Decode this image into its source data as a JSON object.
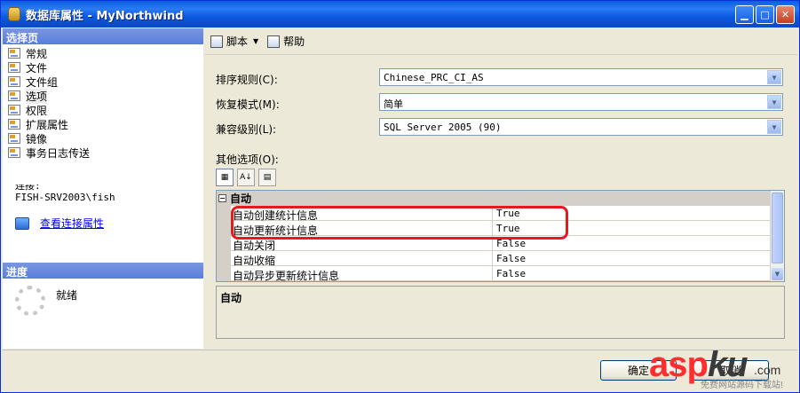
{
  "window": {
    "title": "数据库属性 - MyNorthwind",
    "minimize_label": "▁",
    "maximize_label": "□",
    "close_label": "✕"
  },
  "left": {
    "select_page_header": "选择页",
    "pages": [
      {
        "label": "常规"
      },
      {
        "label": "文件"
      },
      {
        "label": "文件组"
      },
      {
        "label": "选项"
      },
      {
        "label": "权限"
      },
      {
        "label": "扩展属性"
      },
      {
        "label": "镜像"
      },
      {
        "label": "事务日志传送"
      }
    ],
    "connection_label": "连接:",
    "connection_server": "FISH-SRV2003\\fish",
    "view_connection_link": "查看连接属性",
    "progress_header": "进度",
    "progress_status": "就绪"
  },
  "toolbar": {
    "script_label": "脚本",
    "script_arrow": "▼",
    "help_label": "帮助"
  },
  "props": {
    "collation_label": "排序规则(C):",
    "collation_value": "Chinese_PRC_CI_AS",
    "recovery_label": "恢复模式(M):",
    "recovery_value": "简单",
    "compat_label": "兼容级别(L):",
    "compat_value": "SQL Server 2005 (90)",
    "other_options_label": "其他选项(O):",
    "dropdown_glyph": "▼"
  },
  "grid": {
    "category": "自动",
    "toggle": "−",
    "rows": [
      {
        "name": "自动创建统计信息",
        "value": "True"
      },
      {
        "name": "自动更新统计信息",
        "value": "True"
      },
      {
        "name": "自动关闭",
        "value": "False"
      },
      {
        "name": "自动收缩",
        "value": "False"
      },
      {
        "name": "自动异步更新统计信息",
        "value": "False"
      }
    ],
    "sort_categorized_glyph": "▦",
    "sort_alpha_glyph": "A↓",
    "property_pages_glyph": "▤",
    "scroll_down_glyph": "▼"
  },
  "description": {
    "title": "自动"
  },
  "buttons": {
    "ok": "确定",
    "cancel": "取消"
  },
  "watermark": {
    "asp": "asp",
    "ku": "ku",
    "com": ".com",
    "sub": "免费网站源码下载站!"
  },
  "colors": {
    "titlebar": "#0a5fe0",
    "panel_header": "#5a7edc",
    "highlight": "#e51b1b",
    "link": "#0000ee"
  }
}
